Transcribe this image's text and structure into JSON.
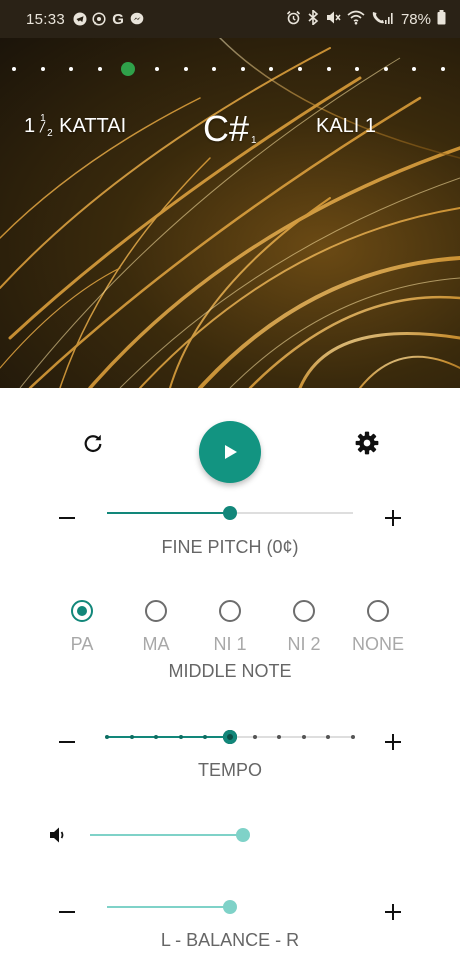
{
  "status_bar": {
    "time": "15:33",
    "battery": "78%",
    "left_icons": [
      "telegram-icon",
      "whatsapp-icon",
      "google-icon",
      "messenger-icon"
    ],
    "right_icons": [
      "alarm-icon",
      "bluetooth-icon",
      "mute-icon",
      "wifi-icon",
      "call-signal-icon",
      "battery-icon"
    ]
  },
  "hero": {
    "page_count": 16,
    "active_page": 4,
    "kattai": {
      "whole": "1",
      "num": "1",
      "den": "2",
      "label": "KATTAI"
    },
    "note": {
      "name": "C#",
      "sub": "1"
    },
    "kali": "KALI 1"
  },
  "controls": {
    "refresh_icon": "refresh-icon",
    "play_icon": "play-icon",
    "settings_icon": "gear-icon"
  },
  "fine_pitch": {
    "label": "FINE PITCH (0¢)",
    "value_fraction": 0.5
  },
  "middle_note": {
    "label": "MIDDLE NOTE",
    "options": [
      "PA",
      "MA",
      "NI 1",
      "NI 2",
      "NONE"
    ],
    "selected": "PA"
  },
  "tempo": {
    "label": "TEMPO",
    "steps": 11,
    "selected_step": 5
  },
  "volume": {
    "icon": "volume-icon",
    "value_fraction": 1.0
  },
  "balance": {
    "label": "L - BALANCE - R",
    "value_fraction": 0.5
  },
  "colors": {
    "accent": "#12877a",
    "accent_light": "#7fd2c8",
    "page_indicator_active": "#2fa14a"
  }
}
